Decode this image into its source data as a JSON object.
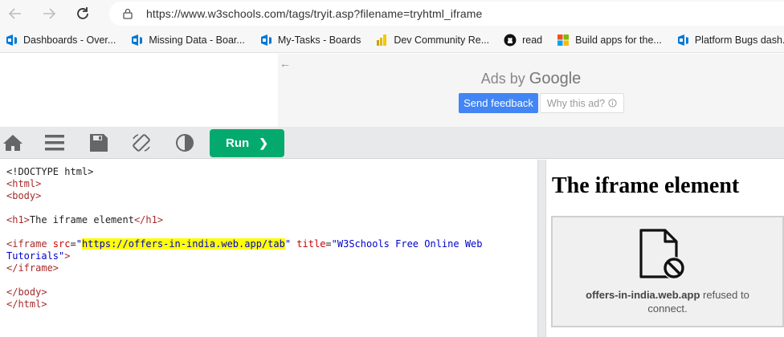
{
  "browser": {
    "url": "https://www.w3schools.com/tags/tryit.asp?filename=tryhtml_iframe"
  },
  "bookmarks": [
    {
      "label": "Dashboards - Over...",
      "icon": "devops-icon"
    },
    {
      "label": "Missing Data - Boar...",
      "icon": "devops-icon"
    },
    {
      "label": "My-Tasks - Boards",
      "icon": "devops-icon"
    },
    {
      "label": "Dev Community Re...",
      "icon": "powerbi-icon"
    },
    {
      "label": "read",
      "icon": "github-icon"
    },
    {
      "label": "Build apps for the...",
      "icon": "microsoft-icon"
    },
    {
      "label": "Platform Bugs dash...",
      "icon": "devops-icon"
    }
  ],
  "ad": {
    "ads_by": "Ads by",
    "google": "Google",
    "send_feedback": "Send feedback",
    "why_this_ad": "Why this ad?"
  },
  "toolbar": {
    "run_label": "Run"
  },
  "code": {
    "doctype": "<!DOCTYPE html>",
    "html_open": "<html>",
    "body_open": "<body>",
    "h1_open": "<h1>",
    "h1_text": "The iframe element",
    "h1_close": "</h1>",
    "iframe_open": "<iframe ",
    "src_attr": "src",
    "eq": "=",
    "quote": "\"",
    "src_value": "https://offers-in-india.web.app/tab",
    "title_attr": "title",
    "title_value_1": "\"W3Schools Free Online Web",
    "title_value_2": "Tutorials\"",
    "gt": ">",
    "iframe_close": "</iframe>",
    "body_close": "</body>",
    "html_close": "</html>"
  },
  "result": {
    "heading": "The iframe element",
    "refused_host": "offers-in-india.web.app",
    "refused_text_1": " refused to",
    "refused_text_2": "connect."
  },
  "colors": {
    "run_button": "#04aa6d",
    "send_feedback": "#4285f4",
    "highlight": "#ffff00"
  }
}
